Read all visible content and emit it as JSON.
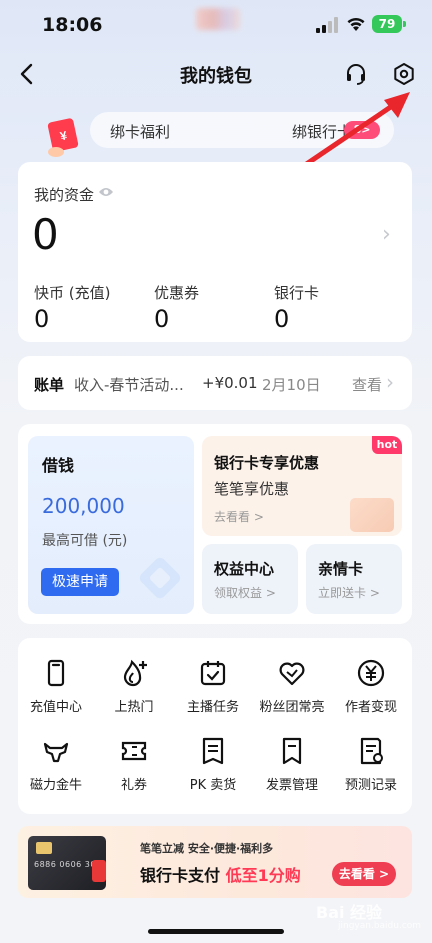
{
  "status_bar": {
    "time": "18:06",
    "battery": "79"
  },
  "header": {
    "title": "我的钱包"
  },
  "banner": {
    "left_text": "绑卡福利",
    "right_text": "绑银行卡",
    "badge": "8>"
  },
  "assets": {
    "label": "我的资金",
    "value": "0",
    "stats": [
      {
        "label": "快币 (充值)",
        "value": "0"
      },
      {
        "label": "优惠券",
        "value": "0"
      },
      {
        "label": "银行卡",
        "value": "0"
      }
    ]
  },
  "bill": {
    "title": "账单",
    "desc": "收入-春节活动...",
    "amount": "+¥0.01",
    "date": "2月10日",
    "view": "查看"
  },
  "borrow": {
    "title": "借钱",
    "amount": "200,000",
    "sub": "最高可借 (元)",
    "button": "极速申请"
  },
  "promo": {
    "title": "银行卡专享优惠",
    "sub": "笔笔享优惠",
    "link": "去看看 >",
    "badge": "hot"
  },
  "rights": {
    "title": "权益中心",
    "sub": "领取权益 >"
  },
  "family": {
    "title": "亲情卡",
    "sub": "立即送卡 >"
  },
  "services": [
    {
      "label": "充值中心",
      "icon": "phone-icon"
    },
    {
      "label": "上热门",
      "icon": "flame-plus-icon"
    },
    {
      "label": "主播任务",
      "icon": "calendar-check-icon"
    },
    {
      "label": "粉丝团常亮",
      "icon": "heart-icon"
    },
    {
      "label": "作者变现",
      "icon": "yen-circle-icon"
    },
    {
      "label": "磁力金牛",
      "icon": "bull-icon"
    },
    {
      "label": "礼券",
      "icon": "ticket-icon"
    },
    {
      "label": "PK 卖货",
      "icon": "document-icon"
    },
    {
      "label": "发票管理",
      "icon": "invoice-icon"
    },
    {
      "label": "预测记录",
      "icon": "record-icon"
    }
  ],
  "ad": {
    "line1": "笔笔立减  安全·便捷·福利多",
    "line2_a": "银行卡支付 ",
    "line2_b": "低至1分购",
    "button": "去看看 >",
    "card_number": "6886 0606 303"
  },
  "watermark": {
    "text": "Bai 经验",
    "sub": "jingyan.baidu.com"
  }
}
